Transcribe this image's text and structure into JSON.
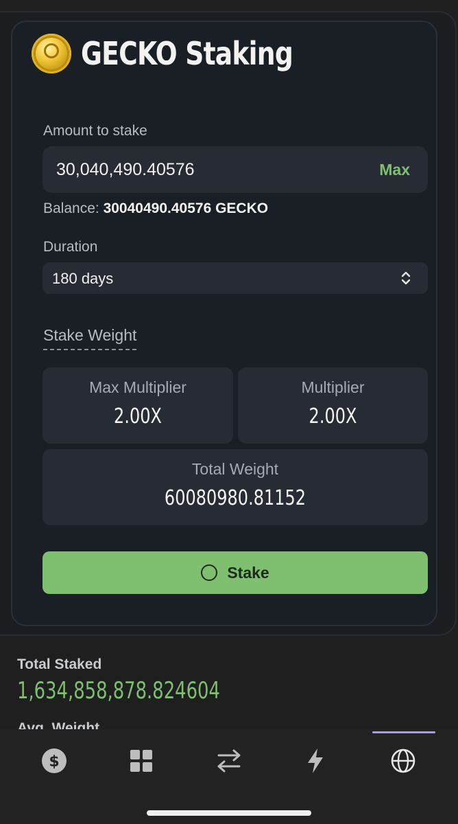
{
  "header": {
    "title": "GECKO Staking",
    "token_icon": "gecko-coin-icon"
  },
  "stake_form": {
    "amount_label": "Amount to stake",
    "amount_value": "30,040,490.40576",
    "max_label": "Max",
    "balance_label": "Balance:",
    "balance_value": "30040490.40576 GECKO",
    "duration_label": "Duration",
    "duration_value": "180 days",
    "stake_weight_label": "Stake Weight",
    "max_multiplier_label": "Max Multiplier",
    "max_multiplier_value": "2.00X",
    "multiplier_label": "Multiplier",
    "multiplier_value": "2.00X",
    "total_weight_label": "Total Weight",
    "total_weight_value": "60080980.81152",
    "stake_button_label": "Stake"
  },
  "stats": {
    "total_staked_label": "Total Staked",
    "total_staked_value": "1,634,858,878.824604",
    "avg_weight_label": "Avg. Weight"
  },
  "bottom_nav": {
    "items": [
      {
        "icon": "dollar-icon"
      },
      {
        "icon": "grid-icon"
      },
      {
        "icon": "swap-icon"
      },
      {
        "icon": "lightning-icon"
      },
      {
        "icon": "globe-icon",
        "active": true
      }
    ]
  },
  "colors": {
    "accent_green": "#7cc070",
    "nav_active_indicator": "#a99cf0",
    "card_bg": "#1a1f26"
  }
}
